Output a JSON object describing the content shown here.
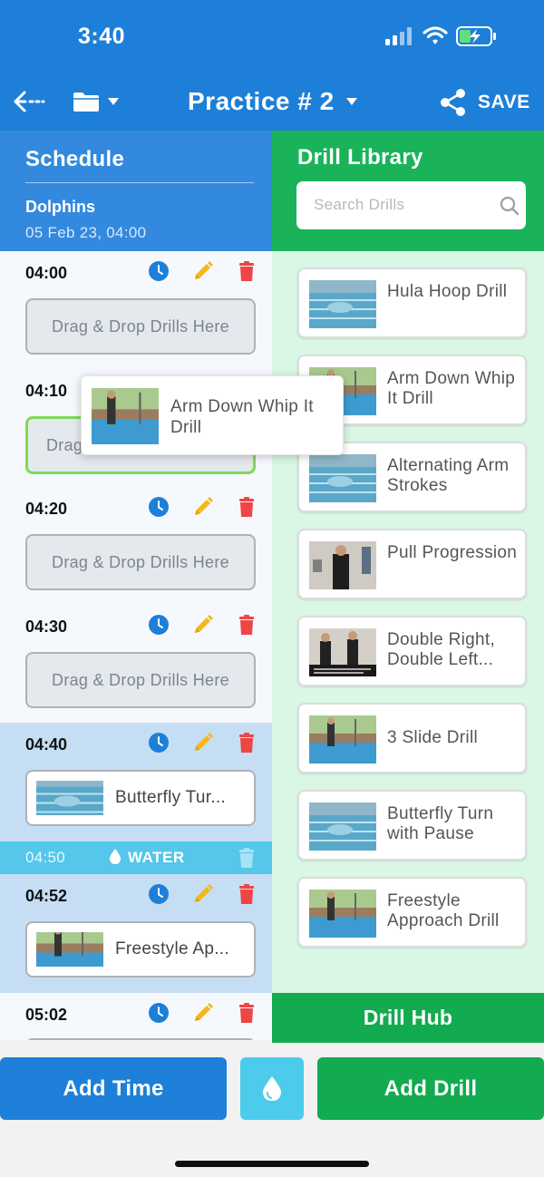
{
  "status_bar": {
    "time": "3:40"
  },
  "nav": {
    "title": "Practice # 2",
    "save_label": "SAVE"
  },
  "schedule": {
    "heading": "Schedule",
    "team": "Dolphins",
    "date": "05 Feb 23, 04:00",
    "drop_placeholder": "Drag & Drop Drills Here",
    "slots": [
      {
        "time": "04:00",
        "drill": ""
      },
      {
        "time": "04:10",
        "drill": "",
        "partial_text": "Drag"
      },
      {
        "time": "04:20",
        "drill": ""
      },
      {
        "time": "04:30",
        "drill": ""
      },
      {
        "time": "04:40",
        "drill": "Butterfly Tur..."
      },
      {
        "time": "04:52",
        "drill": "Freestyle Ap..."
      },
      {
        "time": "05:02",
        "drill": ""
      }
    ],
    "water": {
      "time": "04:50",
      "label": "WATER"
    }
  },
  "dragging": {
    "name": "Arm Down Whip It Drill"
  },
  "library": {
    "heading": "Drill Library",
    "search_placeholder": "Search Drills",
    "drills": [
      {
        "name": "Hula Hoop Drill"
      },
      {
        "name": "Arm Down Whip It Drill"
      },
      {
        "name": "Alternating Arm Strokes"
      },
      {
        "name": "Pull Progression"
      },
      {
        "name": "Double Right, Double Left..."
      },
      {
        "name": "3 Slide Drill"
      },
      {
        "name": "Butterfly Turn with Pause"
      },
      {
        "name": "Freestyle Approach Drill"
      }
    ],
    "hub_label": "Drill Hub"
  },
  "bottom": {
    "add_time": "Add Time",
    "add_drill": "Add Drill"
  },
  "colors": {
    "primary_blue": "#1e7fd8",
    "schedule_header": "#3389de",
    "library_green": "#1ab35a",
    "water_cyan": "#54c7ea",
    "clock_icon": "#1e7fd8",
    "pencil_icon": "#f4b81c",
    "trash_icon": "#ee4545",
    "drop_active_border": "#7ed957"
  },
  "icons": {
    "back": "back-arrow-icon",
    "folder": "folder-icon",
    "share": "share-icon",
    "clock": "clock-icon",
    "edit": "pencil-icon",
    "delete": "trash-icon",
    "water": "water-drop-icon",
    "search": "search-icon"
  }
}
